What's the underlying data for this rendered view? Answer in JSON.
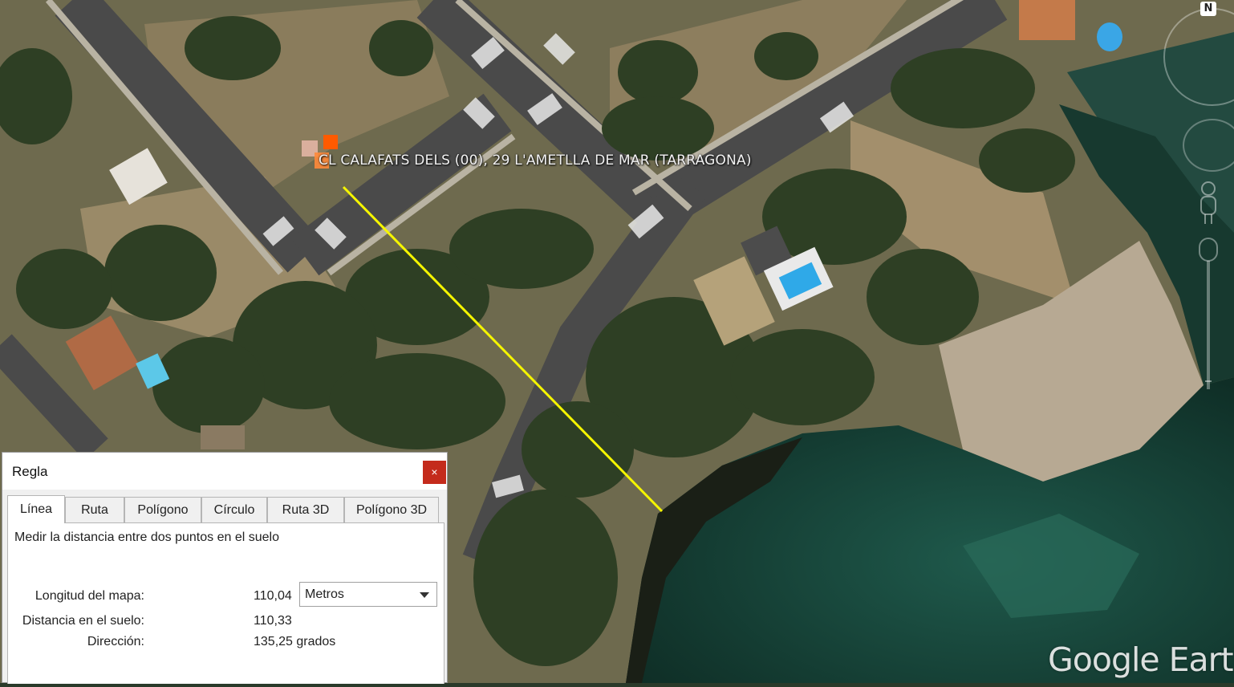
{
  "map": {
    "placemark_label": "CL CALAFATS DELS (00), 29  L'AMETLLA DE MAR (TARRAGONA)",
    "watermark": "Google Earth",
    "compass_letter": "N",
    "measure_line_color": "#f5f500"
  },
  "dialog": {
    "title": "Regla",
    "close_label": "×",
    "tabs": [
      {
        "label": "Línea",
        "active": true
      },
      {
        "label": "Ruta"
      },
      {
        "label": "Polígono"
      },
      {
        "label": "Círculo"
      },
      {
        "label": "Ruta 3D"
      },
      {
        "label": "Polígono 3D"
      }
    ],
    "description": "Medir la distancia entre dos puntos en el suelo",
    "map_length_label": "Longitud del mapa:",
    "map_length_value": "110,04",
    "unit_selected": "Metros",
    "ground_distance_label": "Distancia en el suelo:",
    "ground_distance_value": "110,33",
    "heading_label": "Dirección:",
    "heading_value": "135,25 grados"
  }
}
